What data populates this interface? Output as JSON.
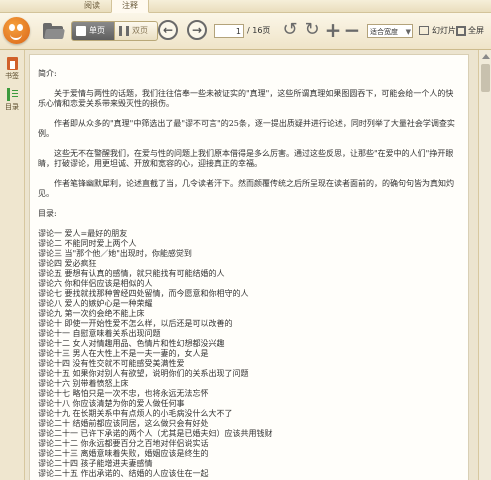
{
  "tabs": [
    {
      "label": "阅读"
    },
    {
      "label": "注释"
    }
  ],
  "toolbar": {
    "single_label": "单页",
    "double_label": "双页",
    "prev_symbol": "←",
    "next_symbol": "→",
    "page_current": "1",
    "page_total": "/ 16页",
    "rotate_ccw_symbol": "↺",
    "rotate_cw_symbol": "↻",
    "zoom_in_symbol": "+",
    "zoom_out_symbol": "−",
    "zoom_value": "适合宽度",
    "slideshow_label": "幻灯片",
    "fullscreen_label": "全屏"
  },
  "sidebar": {
    "bookmark_label": "书签",
    "toc_label": "目录"
  },
  "icons": {
    "logo": "reader-logo-icon",
    "folder": "open-folder-icon",
    "single": "single-page-icon",
    "double": "double-page-icon",
    "prev": "arrow-left-icon",
    "next": "arrow-right-icon",
    "rotate_ccw": "rotate-left-icon",
    "rotate_cw": "rotate-right-icon",
    "zoom_in": "plus-icon",
    "zoom_out": "minus-icon",
    "slideshow": "slideshow-icon",
    "fullscreen": "fullscreen-icon",
    "bookmark": "bookmark-icon",
    "toc": "toc-icon"
  },
  "colors": {
    "accent_orange": "#d9661a",
    "toc_green": "#3d9a3d",
    "background": "#ece4cf"
  },
  "document": {
    "intro_heading": "简介:",
    "paragraphs": [
      "关于爱情与两性的话题，我们往往信奉一些未被证实的\"真理\"，这些所谓真理如果图圆吞下，可能会给一个人的快乐心情和恋爱关系带来毁灭性的损伤。",
      "作者即从众多的\"真理\"中筛选出了最\"谬不可言\"的25条，逐一提出质疑并进行论述，同时列举了大量社会学调查实例。",
      "这些无不在警醒我们，在爱与性的问题上我们原本借得是多么厉害。通过这些反思，让那些\"在爱中的人们\"挣开眼睛，打破谬论，用更坦诚、开放和宽容的心，迎接真正的幸福。",
      "作者笔锋幽默犀利，论述直截了当，几令读者汗下。然而颜覆传统之后所呈现在读者面前的，的确句句皆为真知灼见。"
    ],
    "toc_heading": "目录:",
    "toc_items": [
      "谬论一 爱人=最好的朋友",
      "谬论二 不能同时爱上两个人",
      "谬论三 当\"那个他／她\"出现时，你能感觉到",
      "谬论四 爱必疯狂",
      "谬论五 要想有认真的感情，就只能找有可能结婚的人",
      "谬论六 你和伴侣应该是相似的人",
      "谬论七 要找就找那种曾经四处留情，而今愿意和你相守的人",
      "谬论八 爱人的嫉妒心是一种荣耀",
      "谬论九 第一次约会绝不能上床",
      "谬论十 即使一开始性爱不怎么样，以后还是可以改善的",
      "谬论十一 自慰意味着关系出现问题",
      "谬论十二 女人对情趣用品、色情片和性幻想都没兴趣",
      "谬论十三 男人在大性上不是一夫一妻的，女人是",
      "谬论十四 没有性交就不可能感受美满性爱",
      "谬论十五 如果你对别人有欲望，说明你们的关系出现了问题",
      "谬论十六 别带着愤怒上床",
      "谬论十七 略怕只是一次不忠，也将永远无法忘怀",
      "谬论十八 你应该清楚为你的爱人做任何事",
      "谬论十九 在长期关系中有点烦人的小毛病没什么大不了",
      "谬论二十 结婚前都应该同居，这么做只会有好处",
      "谬论二十一 已许下承诺的两个人（尤其是已婚夫妇）应该共用钱财",
      "谬论二十二 你永远都要百分之百地对伴侣说实话",
      "谬论二十三 离婚意味着失败，婚姻应该是终生的",
      "谬论二十四 孩子能增进夫妻感情",
      "谬论二十五 作出承诺的、结婚的人应该住在一起"
    ]
  }
}
